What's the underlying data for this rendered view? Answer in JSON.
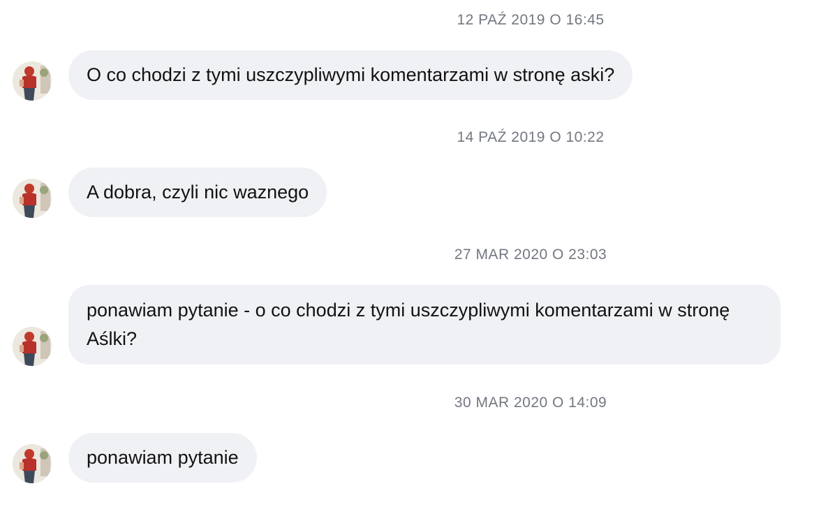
{
  "messages": [
    {
      "timestamp": "12 PAŹ 2019 O 16:45",
      "text": "O co chodzi z tymi uszczypliwymi komentarzami w stronę aski?"
    },
    {
      "timestamp": "14 PAŹ 2019 O 10:22",
      "text": "A dobra, czyli nic waznego"
    },
    {
      "timestamp": "27 MAR 2020 O 23:03",
      "text": "ponawiam pytanie - o co chodzi z tymi uszczypliwymi komentarzami w stronę Aślki?"
    },
    {
      "timestamp": "30 MAR 2020 O 14:09",
      "text": "ponawiam pytanie"
    }
  ],
  "colors": {
    "bubble_bg": "#f0f1f5",
    "timestamp_text": "#737780",
    "message_text": "#121212"
  },
  "icons": {
    "avatar": "user-photo-avatar-icon"
  }
}
